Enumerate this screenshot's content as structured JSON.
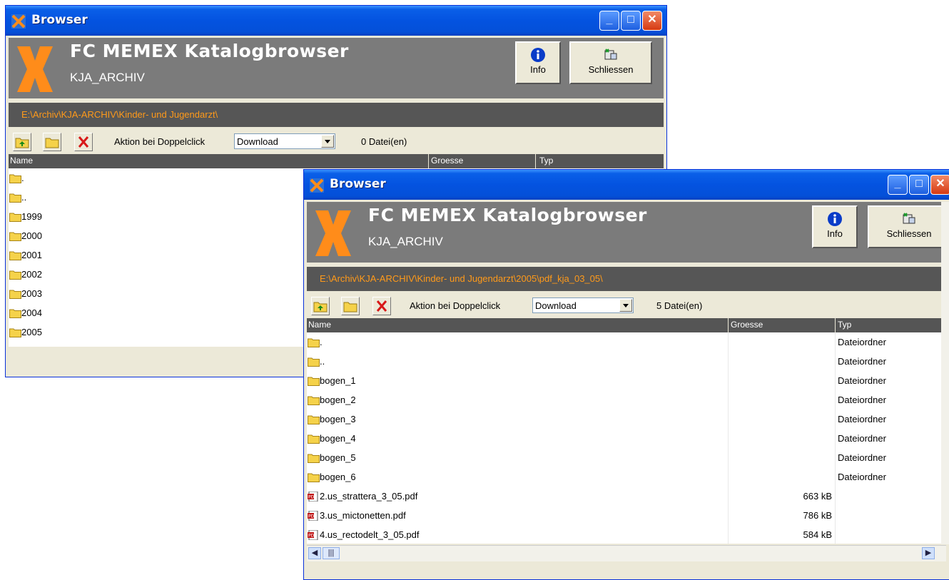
{
  "colors": {
    "title_bar": "#0453e0",
    "banner": "#7b7b7b",
    "path_bar": "#565656",
    "path_text": "#ff9a1a",
    "logo": "#ff8c1a"
  },
  "back_window": {
    "title": "Browser",
    "app_name": "FC MEMEX Katalogbrowser",
    "archive": "KJA_ARCHIV",
    "buttons": {
      "info": "Info",
      "close": "Schliessen"
    },
    "path": "E:\\Archiv\\KJA-ARCHIV\\Kinder- und Jugendarzt\\",
    "action_label": "Aktion bei Doppelclick",
    "action_value": "Download",
    "file_count": "0 Datei(en)",
    "columns": {
      "name": "Name",
      "size": "Groesse",
      "type": "Typ"
    },
    "rows": [
      {
        "name": ".",
        "icon": "folder-icon"
      },
      {
        "name": "..",
        "icon": "folder-icon"
      },
      {
        "name": "1999",
        "icon": "folder-icon"
      },
      {
        "name": "2000",
        "icon": "folder-icon"
      },
      {
        "name": "2001",
        "icon": "folder-icon"
      },
      {
        "name": "2002",
        "icon": "folder-icon"
      },
      {
        "name": "2003",
        "icon": "folder-icon"
      },
      {
        "name": "2004",
        "icon": "folder-icon"
      },
      {
        "name": "2005",
        "icon": "folder-icon"
      }
    ]
  },
  "front_window": {
    "title": "Browser",
    "app_name": "FC MEMEX Katalogbrowser",
    "archive": "KJA_ARCHIV",
    "buttons": {
      "info": "Info",
      "close": "Schliessen"
    },
    "path": "E:\\Archiv\\KJA-ARCHIV\\Kinder- und Jugendarzt\\2005\\pdf_kja_03_05\\",
    "action_label": "Aktion bei Doppelclick",
    "action_value": "Download",
    "file_count": "5 Datei(en)",
    "columns": {
      "name": "Name",
      "size": "Groesse",
      "type": "Typ"
    },
    "rows": [
      {
        "name": ".",
        "size": "",
        "type": "Dateiordner",
        "icon": "folder-icon"
      },
      {
        "name": "..",
        "size": "",
        "type": "Dateiordner",
        "icon": "folder-icon"
      },
      {
        "name": "bogen_1",
        "size": "",
        "type": "Dateiordner",
        "icon": "folder-icon"
      },
      {
        "name": "bogen_2",
        "size": "",
        "type": "Dateiordner",
        "icon": "folder-icon"
      },
      {
        "name": "bogen_3",
        "size": "",
        "type": "Dateiordner",
        "icon": "folder-icon"
      },
      {
        "name": "bogen_4",
        "size": "",
        "type": "Dateiordner",
        "icon": "folder-icon"
      },
      {
        "name": "bogen_5",
        "size": "",
        "type": "Dateiordner",
        "icon": "folder-icon"
      },
      {
        "name": "bogen_6",
        "size": "",
        "type": "Dateiordner",
        "icon": "folder-icon"
      },
      {
        "name": "2.us_strattera_3_05.pdf",
        "size": "663 kB",
        "type": "",
        "icon": "pdf-icon"
      },
      {
        "name": "3.us_mictonetten.pdf",
        "size": "786 kB",
        "type": "",
        "icon": "pdf-icon"
      },
      {
        "name": "4.us_rectodelt_3_05.pdf",
        "size": "584 kB",
        "type": "",
        "icon": "pdf-icon"
      }
    ]
  }
}
